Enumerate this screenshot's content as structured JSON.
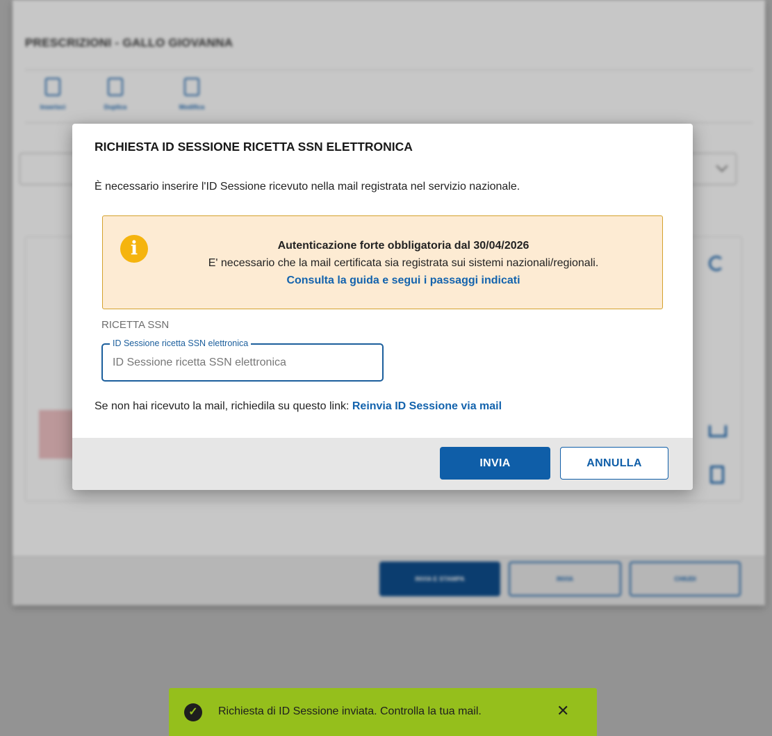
{
  "background": {
    "title": "PRESCRIZIONI - GALLO GIOVANNA",
    "toolbar": [
      "Inserisci",
      "Duplica",
      "Modifica"
    ],
    "footer_buttons": [
      "INVIA E STAMPA",
      "INVIA",
      "CHIUDI"
    ]
  },
  "modal": {
    "title": "RICHIESTA ID SESSIONE RICETTA SSN ELETTRONICA",
    "description": "È necessario inserire l'ID Sessione ricevuto nella mail registrata nel servizio nazionale.",
    "alert": {
      "icon": "info-icon",
      "heading": "Autenticazione forte obbligatoria dal 30/04/2026",
      "body": "E' necessario che la mail certificata sia registrata sui sistemi nazionali/regionali.",
      "link": "Consulta la guida e segui i passaggi indicati"
    },
    "section_label": "RICETTA SSN",
    "field": {
      "label": "ID Sessione ricetta SSN elettronica",
      "placeholder": "ID Sessione ricetta SSN elettronica",
      "value": ""
    },
    "resend": {
      "text": "Se non hai ricevuto la mail, richiedila su questo link: ",
      "link": "Reinvia ID Sessione via mail"
    },
    "buttons": {
      "submit": "INVIA",
      "cancel": "ANNULLA"
    }
  },
  "toast": {
    "icon": "check-circle-icon",
    "message": "Richiesta di ID Sessione inviata. Controlla la tua mail.",
    "close_icon": "close-icon"
  },
  "colors": {
    "primary": "#0f5ea8",
    "alert_bg": "#fdebd3",
    "alert_border": "#d4a12c",
    "info_icon": "#f5b40e",
    "toast_bg": "#95bf1c"
  }
}
